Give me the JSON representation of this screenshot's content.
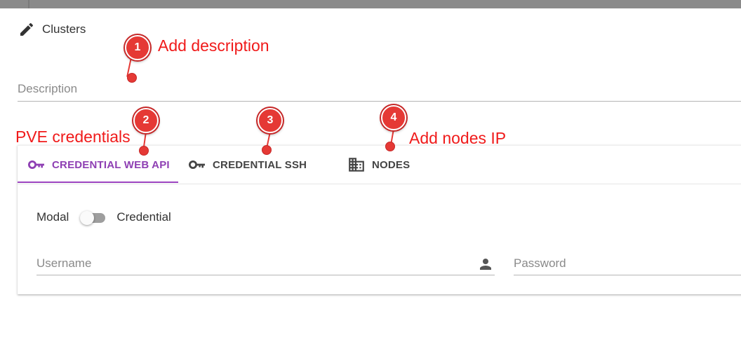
{
  "header": {
    "title": "Clusters",
    "icon": "pencil-icon"
  },
  "description": {
    "placeholder": "Description"
  },
  "tabs": [
    {
      "label": "CREDENTIAL WEB API",
      "icon": "key-icon",
      "active": true
    },
    {
      "label": "CREDENTIAL SSH",
      "icon": "key-icon",
      "active": false
    },
    {
      "label": "NODES",
      "icon": "building-icon",
      "active": false
    }
  ],
  "mode_toggle": {
    "left_label": "Modal",
    "right_label": "Credential",
    "checked": false
  },
  "fields": {
    "username": {
      "placeholder": "Username",
      "icon": "person-icon"
    },
    "password": {
      "placeholder": "Password"
    }
  },
  "annotations": [
    {
      "number": "1",
      "text": "Add description"
    },
    {
      "number": "2",
      "text": "PVE credentials"
    },
    {
      "number": "3",
      "text": ""
    },
    {
      "number": "4",
      "text": "Add nodes IP"
    }
  ],
  "colors": {
    "accent": "#9b44c0",
    "annotation": "#e53935",
    "topbar": "#8a8a8a"
  }
}
